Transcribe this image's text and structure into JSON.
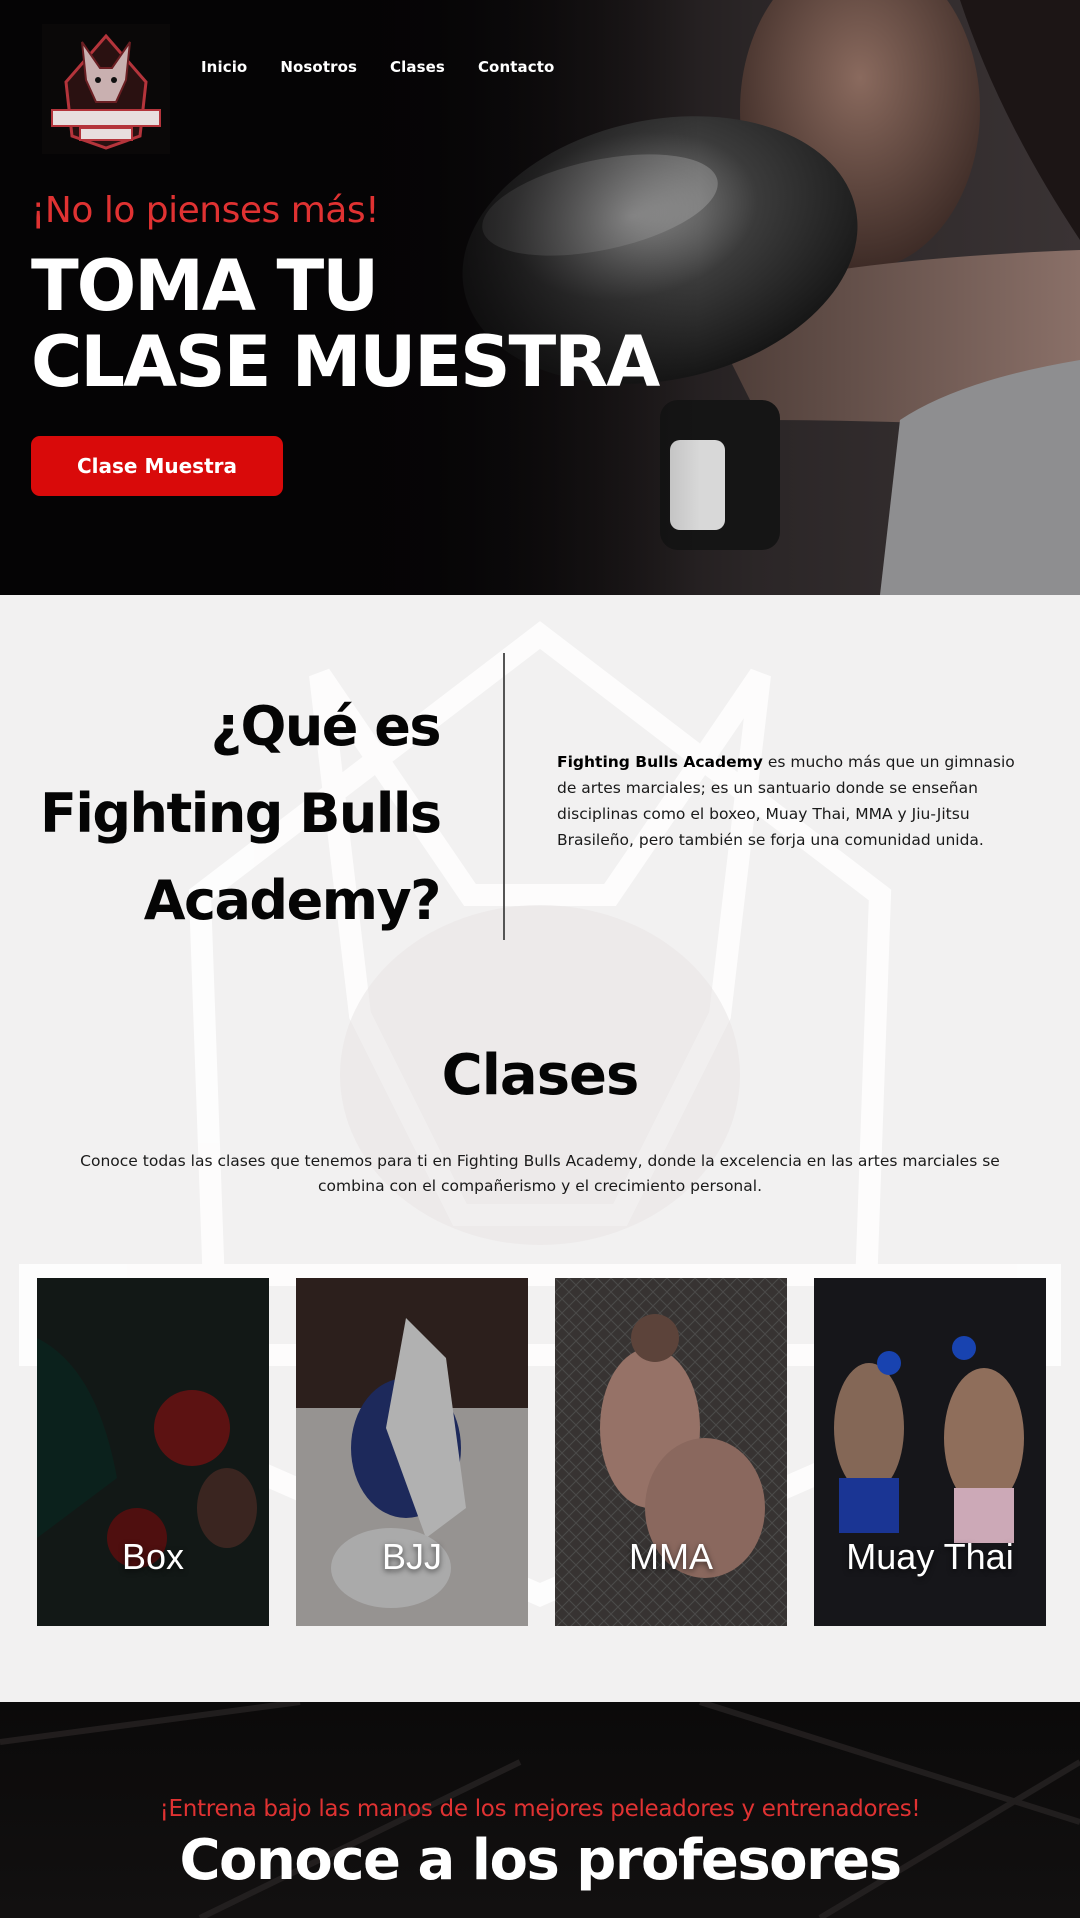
{
  "logo": {
    "line1": "FIGHTING BULLS",
    "line2": "ACADEMY"
  },
  "nav": {
    "items": [
      {
        "label": "Inicio"
      },
      {
        "label": "Nosotros"
      },
      {
        "label": "Clases"
      },
      {
        "label": "Contacto"
      }
    ]
  },
  "hero": {
    "kicker": "¡No lo pienses más!",
    "title_line1": "TOMA TU",
    "title_line2": "CLASE MUESTRA",
    "cta_label": "Clase Muestra"
  },
  "about": {
    "title_line1": "¿Qué es",
    "title_line2": "Fighting Bulls",
    "title_line3": "Academy?",
    "text_bold": "Fighting Bulls Academy",
    "text_rest": " es mucho más que un gimnasio de artes marciales; es un santuario donde se enseñan disciplinas como el boxeo, Muay Thai, MMA y Jiu-Jitsu Brasileño, pero también se forja una comunidad unida."
  },
  "clases": {
    "title": "Clases",
    "description": "Conoce todas las clases que tenemos para ti en Fighting Bulls Academy, donde la excelencia en las artes marciales se combina con el compañerismo y el crecimiento personal.",
    "cards": [
      {
        "label": "Box"
      },
      {
        "label": "BJJ"
      },
      {
        "label": "MMA"
      },
      {
        "label": "Muay Thai"
      }
    ]
  },
  "profesores": {
    "kicker": "¡Entrena bajo las manos de los mejores peleadores y entrenadores!",
    "title": "Conoce a los profesores"
  },
  "colors": {
    "accent_red": "#d90a0a",
    "kicker_red": "#e03232",
    "dark": "#050405",
    "light_bg": "#f2f1f1"
  }
}
